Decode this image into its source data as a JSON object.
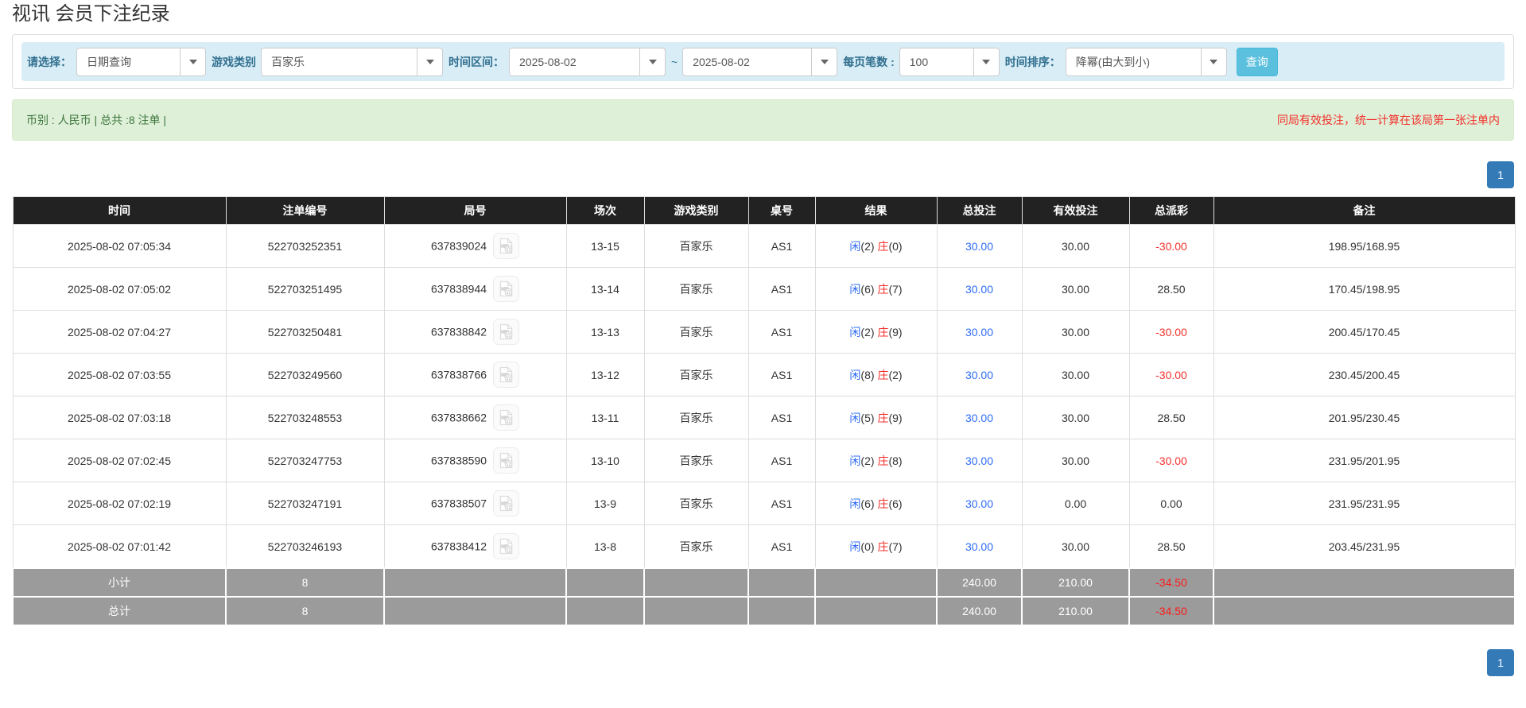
{
  "page": {
    "title": "视讯 会员下注纪录"
  },
  "filters": {
    "query_type_label": "请选择：",
    "query_type_value": "日期查询",
    "game_category_label": "游戏类别",
    "game_category_value": "百家乐",
    "time_range_label": "时间区间：",
    "date_from": "2025-08-02",
    "tilde": "~",
    "date_to": "2025-08-02",
    "page_size_label": "每页笔数 :",
    "page_size_value": "100",
    "sort_label": "时间排序：",
    "sort_value": "降幂(由大到小)",
    "search_button": "查询"
  },
  "summary_bar": {
    "left_text": "币别 : 人民币 | 总共 :8 注单 |",
    "right_note": "同局有效投注，统一计算在该局第一张注单内"
  },
  "pagination": {
    "current_page": "1"
  },
  "table": {
    "headers": [
      "时间",
      "注单编号",
      "局号",
      "场次",
      "游戏类别",
      "桌号",
      "结果",
      "总投注",
      "有效投注",
      "总派彩",
      "备注"
    ],
    "rows": [
      {
        "time": "2025-08-02 07:05:34",
        "bet_id": "522703252351",
        "round_id": "637839024",
        "session": "13-15",
        "game": "百家乐",
        "table_no": "AS1",
        "player_label": "闲",
        "player_score": "(2)",
        "banker_label": "庄",
        "banker_score": "(0)",
        "total_bet": "30.00",
        "valid_bet": "30.00",
        "payout": "-30.00",
        "note": "198.95/168.95"
      },
      {
        "time": "2025-08-02 07:05:02",
        "bet_id": "522703251495",
        "round_id": "637838944",
        "session": "13-14",
        "game": "百家乐",
        "table_no": "AS1",
        "player_label": "闲",
        "player_score": "(6)",
        "banker_label": "庄",
        "banker_score": "(7)",
        "total_bet": "30.00",
        "valid_bet": "30.00",
        "payout": "28.50",
        "note": "170.45/198.95"
      },
      {
        "time": "2025-08-02 07:04:27",
        "bet_id": "522703250481",
        "round_id": "637838842",
        "session": "13-13",
        "game": "百家乐",
        "table_no": "AS1",
        "player_label": "闲",
        "player_score": "(2)",
        "banker_label": "庄",
        "banker_score": "(9)",
        "total_bet": "30.00",
        "valid_bet": "30.00",
        "payout": "-30.00",
        "note": "200.45/170.45"
      },
      {
        "time": "2025-08-02 07:03:55",
        "bet_id": "522703249560",
        "round_id": "637838766",
        "session": "13-12",
        "game": "百家乐",
        "table_no": "AS1",
        "player_label": "闲",
        "player_score": "(8)",
        "banker_label": "庄",
        "banker_score": "(2)",
        "total_bet": "30.00",
        "valid_bet": "30.00",
        "payout": "-30.00",
        "note": "230.45/200.45"
      },
      {
        "time": "2025-08-02 07:03:18",
        "bet_id": "522703248553",
        "round_id": "637838662",
        "session": "13-11",
        "game": "百家乐",
        "table_no": "AS1",
        "player_label": "闲",
        "player_score": "(5)",
        "banker_label": "庄",
        "banker_score": "(9)",
        "total_bet": "30.00",
        "valid_bet": "30.00",
        "payout": "28.50",
        "note": "201.95/230.45"
      },
      {
        "time": "2025-08-02 07:02:45",
        "bet_id": "522703247753",
        "round_id": "637838590",
        "session": "13-10",
        "game": "百家乐",
        "table_no": "AS1",
        "player_label": "闲",
        "player_score": "(2)",
        "banker_label": "庄",
        "banker_score": "(8)",
        "total_bet": "30.00",
        "valid_bet": "30.00",
        "payout": "-30.00",
        "note": "231.95/201.95"
      },
      {
        "time": "2025-08-02 07:02:19",
        "bet_id": "522703247191",
        "round_id": "637838507",
        "session": "13-9",
        "game": "百家乐",
        "table_no": "AS1",
        "player_label": "闲",
        "player_score": "(6)",
        "banker_label": "庄",
        "banker_score": "(6)",
        "total_bet": "30.00",
        "valid_bet": "0.00",
        "payout": "0.00",
        "note": "231.95/231.95"
      },
      {
        "time": "2025-08-02 07:01:42",
        "bet_id": "522703246193",
        "round_id": "637838412",
        "session": "13-8",
        "game": "百家乐",
        "table_no": "AS1",
        "player_label": "闲",
        "player_score": "(0)",
        "banker_label": "庄",
        "banker_score": "(7)",
        "total_bet": "30.00",
        "valid_bet": "30.00",
        "payout": "28.50",
        "note": "203.45/231.95"
      }
    ],
    "subtotal": {
      "label": "小计",
      "count": "8",
      "total_bet": "240.00",
      "valid_bet": "210.00",
      "payout": "-34.50"
    },
    "total": {
      "label": "总计",
      "count": "8",
      "total_bet": "240.00",
      "valid_bet": "210.00",
      "payout": "-34.50"
    }
  },
  "icons": {
    "round_video": "video-file-icon"
  },
  "colors": {
    "accent_info": "#5bc0de",
    "pagination_active": "#337ab7",
    "table_header_bg": "#222222",
    "summary_row_bg": "#9b9b9b",
    "link_blue": "#2e6cf6",
    "negative_red": "#f2302b"
  }
}
